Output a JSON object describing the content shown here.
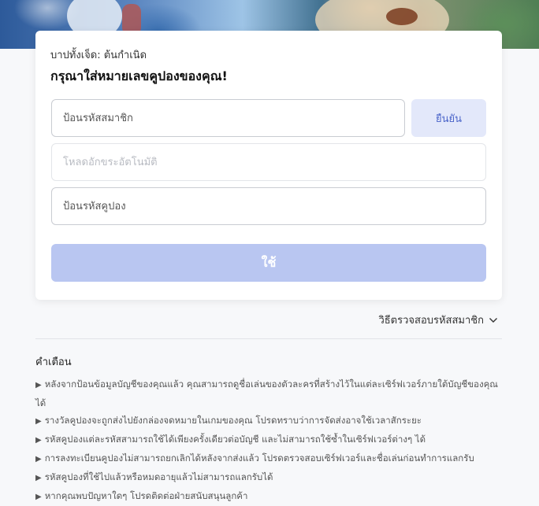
{
  "header": {
    "subtitle": "บาปทั้งเจ็ด: ต้นกำเนิด",
    "title": "กรุณาใส่หมายเลขคูปองของคุณ!"
  },
  "form": {
    "member_placeholder": "ป้อนรหัสสมาชิก",
    "confirm_label": "ยืนยัน",
    "auto_placeholder": "โหลดอักขระอัตโนมัติ",
    "coupon_placeholder": "ป้อนรหัสคูปอง",
    "use_label": "ใช้"
  },
  "verify": {
    "label": "วิธีตรวจสอบรหัสสมาชิก"
  },
  "warnings": {
    "title": "คำเตือน",
    "bullet": "▶",
    "items": [
      "หลังจากป้อนข้อมูลบัญชีของคุณแล้ว คุณสามารถดูชื่อเล่นของตัวละครที่สร้างไว้ในแต่ละเซิร์ฟเวอร์ภายใต้บัญชีของคุณได้",
      "รางวัลคูปองจะถูกส่งไปยังกล่องจดหมายในเกมของคุณ โปรดทราบว่าการจัดส่งอาจใช้เวลาสักระยะ",
      "รหัสคูปองแต่ละรหัสสามารถใช้ได้เพียงครั้งเดียวต่อบัญชี และไม่สามารถใช้ซ้ำในเซิร์ฟเวอร์ต่างๆ ได้",
      "การลงทะเบียนคูปองไม่สามารถยกเลิกได้หลังจากส่งแล้ว โปรดตรวจสอบเซิร์ฟเวอร์และชื่อเล่นก่อนทำการแลกรับ",
      "รหัสคูปองที่ใช้ไปแล้วหรือหมดอายุแล้วไม่สามารถแลกรับได้",
      "หากคุณพบปัญหาใดๆ โปรดติดต่อฝ่ายสนับสนุนลูกค้า"
    ]
  }
}
